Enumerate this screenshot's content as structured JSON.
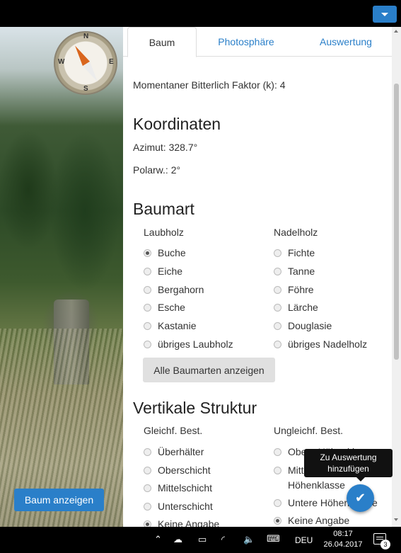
{
  "tabs": [
    {
      "label": "Baum"
    },
    {
      "label": "Photosphäre"
    },
    {
      "label": "Auswertung"
    }
  ],
  "bitterlich": {
    "label": "Momentaner Bitterlich Faktor (k): 4"
  },
  "koordinaten": {
    "heading": "Koordinaten",
    "azimut": "Azimut: 328.7°",
    "polarw": "Polarw.: 2°"
  },
  "compass": {
    "n": "N",
    "s": "S",
    "w": "W",
    "e": "E"
  },
  "baumart": {
    "heading": "Baumart",
    "col1_label": "Laubholz",
    "col2_label": "Nadelholz",
    "laubholz": [
      {
        "label": "Buche",
        "checked": true
      },
      {
        "label": "Eiche",
        "checked": false
      },
      {
        "label": "Bergahorn",
        "checked": false
      },
      {
        "label": "Esche",
        "checked": false
      },
      {
        "label": "Kastanie",
        "checked": false
      },
      {
        "label": "übriges Laubholz",
        "checked": false
      }
    ],
    "nadelholz": [
      {
        "label": "Fichte",
        "checked": false
      },
      {
        "label": "Tanne",
        "checked": false
      },
      {
        "label": "Föhre",
        "checked": false
      },
      {
        "label": "Lärche",
        "checked": false
      },
      {
        "label": "Douglasie",
        "checked": false
      },
      {
        "label": "übriges Nadelholz",
        "checked": false
      }
    ],
    "show_all_button": "Alle Baumarten anzeigen"
  },
  "vertikale": {
    "heading": "Vertikale Struktur",
    "col1_label": "Gleichf. Best.",
    "col2_label": "Ungleichf. Best.",
    "gleichf": [
      {
        "label": "Überhälter",
        "checked": false
      },
      {
        "label": "Oberschicht",
        "checked": false
      },
      {
        "label": "Mittelschicht",
        "checked": false
      },
      {
        "label": "Unterschicht",
        "checked": false
      },
      {
        "label": "Keine Angabe",
        "checked": true
      }
    ],
    "ungleichf": [
      {
        "label": "Obere Höhenklasse",
        "checked": false
      },
      {
        "label": "Mittlere",
        "checked": false
      },
      {
        "label": "Höhenklasse",
        "checked": false
      },
      {
        "label": "Untere Höhenklasse",
        "checked": false
      },
      {
        "label": "Keine Angabe",
        "checked": true
      }
    ]
  },
  "show_tree_button": "Baum anzeigen",
  "tooltip": {
    "line1": "Zu Auswertung",
    "line2": "hinzufügen"
  },
  "fab_icon": "checkmark-icon",
  "taskbar": {
    "language": "DEU",
    "time": "08:17",
    "date": "26.04.2017",
    "notifications": "3"
  },
  "colors": {
    "accent": "#2a7fc9"
  }
}
